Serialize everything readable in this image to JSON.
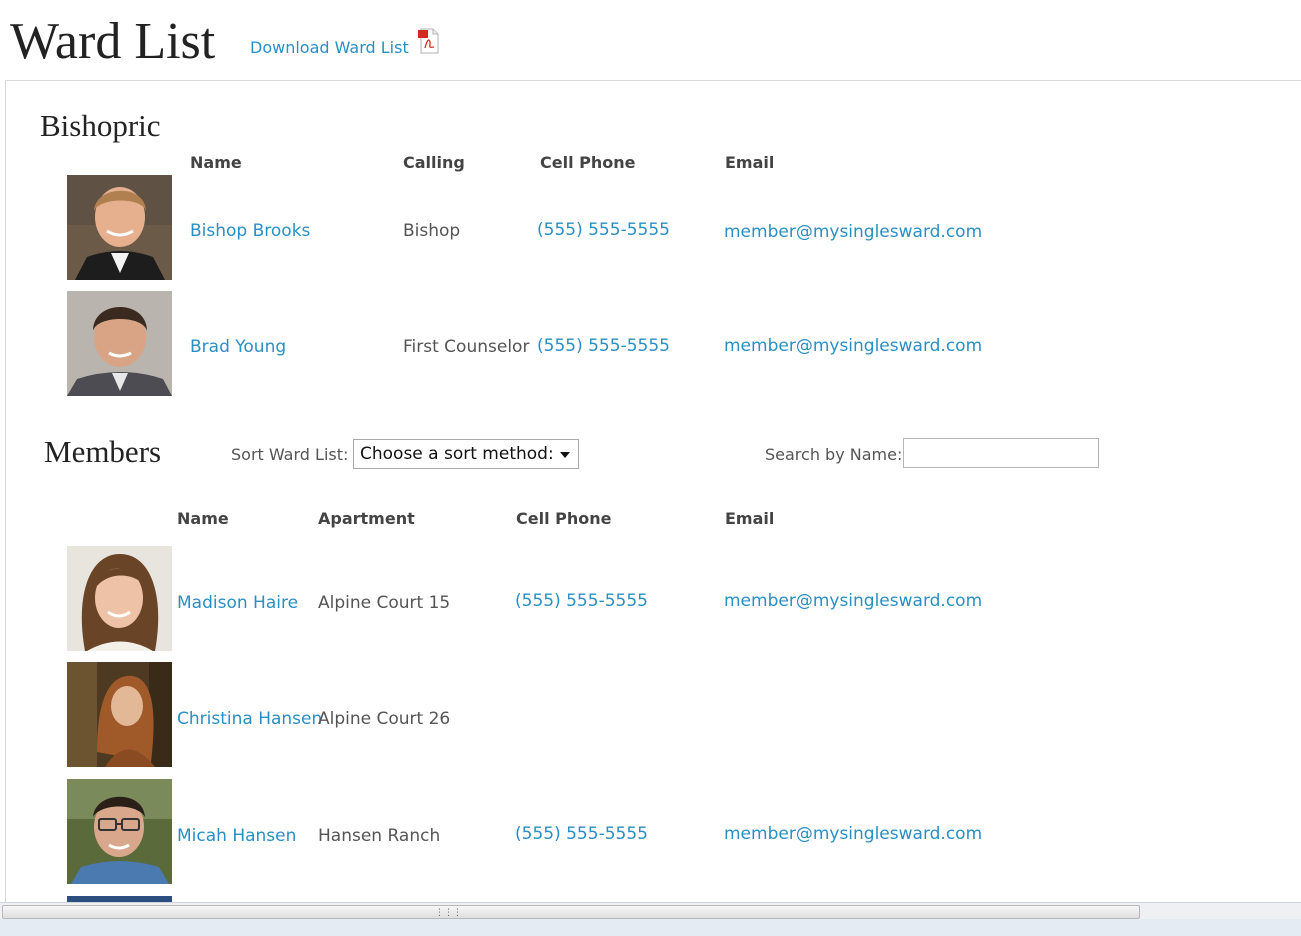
{
  "header": {
    "title": "Ward List",
    "download_label": "Download Ward List",
    "download_icon": "pdf-icon"
  },
  "bishopric": {
    "title": "Bishopric",
    "columns": [
      "Name",
      "Calling",
      "Cell Phone",
      "Email"
    ],
    "rows": [
      {
        "name": "Bishop Brooks",
        "calling": "Bishop",
        "phone": "(555) 555-5555",
        "email": "member@mysinglesward.com",
        "photo": "photo-man-blond"
      },
      {
        "name": "Brad Young",
        "calling": "First Counselor",
        "phone": "(555) 555-5555",
        "email": "member@mysinglesward.com",
        "photo": "photo-man-dark-hair"
      }
    ]
  },
  "members": {
    "title": "Members",
    "sort_label": "Sort Ward List:",
    "sort_selected": "Choose a sort method:",
    "search_label": "Search by Name:",
    "search_value": "",
    "columns": [
      "Name",
      "Apartment",
      "Cell Phone",
      "Email"
    ],
    "rows": [
      {
        "name": "Madison Haire",
        "apartment": "Alpine Court 15",
        "phone": "(555) 555-5555",
        "email": "member@mysinglesward.com",
        "photo": "photo-woman-brown-hair"
      },
      {
        "name": "Christina Hansen",
        "apartment": "Alpine Court 26",
        "phone": "",
        "email": "",
        "photo": "photo-woman-tree"
      },
      {
        "name": "Micah Hansen",
        "apartment": "Hansen Ranch",
        "phone": "(555) 555-5555",
        "email": "member@mysinglesward.com",
        "photo": "photo-man-glasses"
      }
    ]
  },
  "colors": {
    "link": "#2a8fc4",
    "text": "#444444",
    "title": "#222222"
  }
}
